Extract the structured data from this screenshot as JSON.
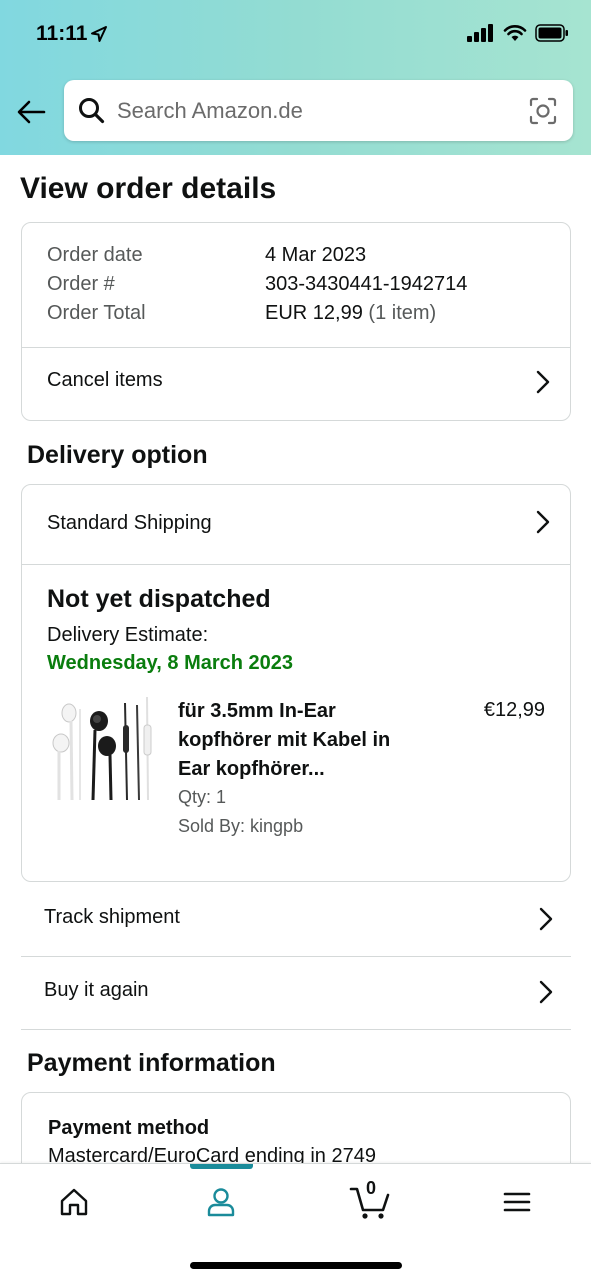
{
  "status": {
    "time": "11:11"
  },
  "search": {
    "placeholder": "Search Amazon.de"
  },
  "page": {
    "title": "View order details"
  },
  "order": {
    "date_label": "Order date",
    "date_value": "4 Mar 2023",
    "number_label": "Order #",
    "number_value": "303-3430441-1942714",
    "total_label": "Order Total",
    "total_value": "EUR 12,99",
    "total_items": "(1 item)",
    "cancel_label": "Cancel items"
  },
  "delivery": {
    "section_title": "Delivery option",
    "option_label": "Standard Shipping",
    "status": "Not yet dispatched",
    "estimate_label": "Delivery Estimate:",
    "estimate_date": "Wednesday, 8 March 2023",
    "product": {
      "title": "für 3.5mm In-Ear kopfhörer mit Kabel in Ear kopfhörer...",
      "price": "€12,99",
      "qty": "Qty: 1",
      "seller": "Sold By: kingpb"
    }
  },
  "actions": {
    "track_label": "Track shipment",
    "buy_again_label": "Buy it again"
  },
  "payment": {
    "section_title": "Payment information",
    "method_title": "Payment method",
    "method_detail": "Mastercard/EuroCard ending in 2749"
  },
  "tabbar": {
    "items": [
      "home-icon",
      "account-icon",
      "cart-icon",
      "menu-icon"
    ],
    "active": "account-icon",
    "cart_count": "0"
  },
  "colors": {
    "header_gradient_start": "#81d8e0",
    "header_gradient_end": "#a6e4d1",
    "delivery_date_green": "#0a7d0e",
    "tab_accent": "#1a8b9a"
  }
}
